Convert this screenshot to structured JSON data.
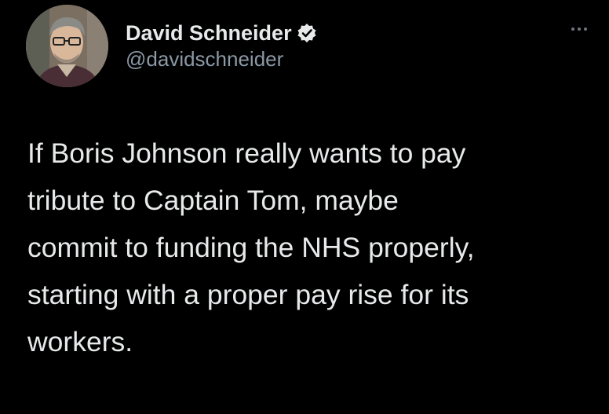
{
  "author": {
    "display_name": "David Schneider",
    "handle": "@davidschneider",
    "verified": true
  },
  "tweet": {
    "lines": [
      "If Boris Johnson really wants to pay",
      "tribute to Captain Tom, maybe",
      "commit to funding the NHS properly,",
      "starting with a proper pay rise for its",
      "workers."
    ]
  },
  "icons": {
    "verified": "verified-badge-icon",
    "more": "more-options-icon"
  },
  "colors": {
    "background": "#000000",
    "text": "#e7e9ea",
    "secondary_text": "#8b98a5",
    "badge": "#e7e9ea"
  }
}
